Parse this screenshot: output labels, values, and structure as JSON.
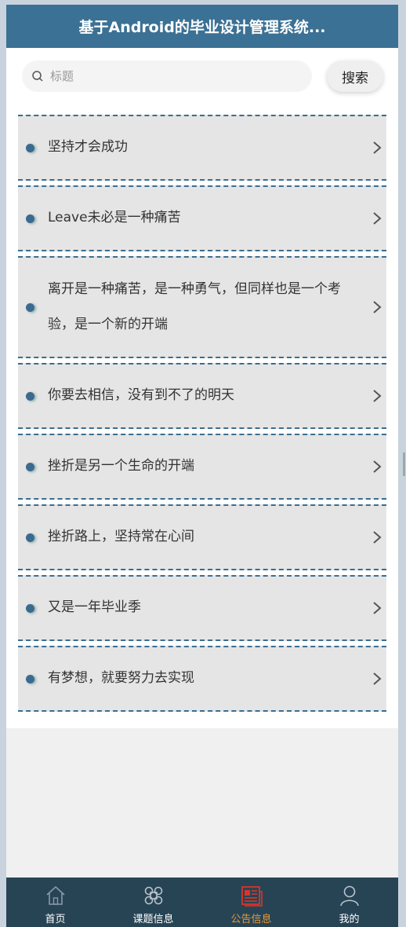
{
  "header": {
    "title": "基于Android的毕业设计管理系统..."
  },
  "search": {
    "placeholder": "标题",
    "button_label": "搜索"
  },
  "notices": [
    {
      "title": "坚持才会成功"
    },
    {
      "title": "Leave未必是一种痛苦"
    },
    {
      "title": "离开是一种痛苦，是一种勇气，但同样也是一个考验，是一个新的开端"
    },
    {
      "title": "你要去相信，没有到不了的明天"
    },
    {
      "title": "挫折是另一个生命的开端"
    },
    {
      "title": "挫折路上，坚持常在心间"
    },
    {
      "title": "又是一年毕业季"
    },
    {
      "title": "有梦想，就要努力去实现"
    }
  ],
  "tabbar": {
    "tabs": [
      {
        "label": "首页",
        "icon": "home-icon"
      },
      {
        "label": "课题信息",
        "icon": "command-icon"
      },
      {
        "label": "公告信息",
        "icon": "news-icon",
        "active": true
      },
      {
        "label": "我的",
        "icon": "user-icon"
      }
    ]
  },
  "colors": {
    "header": "#3b7194",
    "tabbar": "#274455",
    "active_tab": "#e79a3a",
    "accent": "#3b6d8f"
  }
}
